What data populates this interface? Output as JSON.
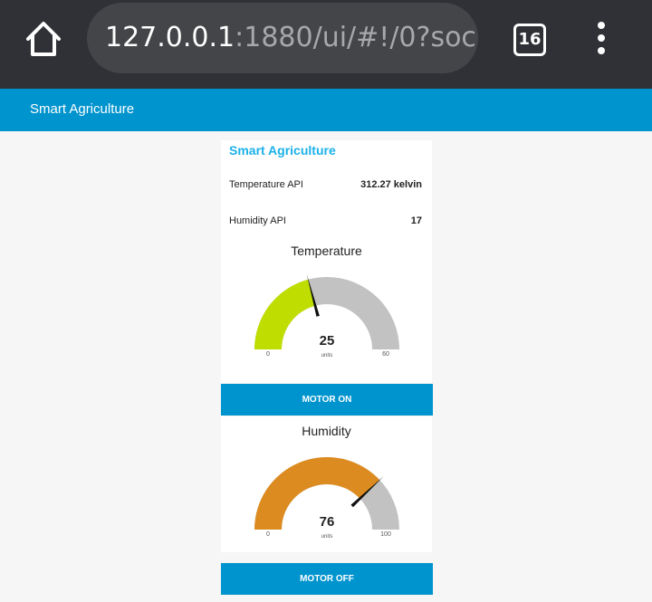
{
  "browser": {
    "url_host": "127.0.0.1",
    "url_path": ":1880/ui/#!/0?soc",
    "tab_count": "16"
  },
  "header": {
    "title": "Smart Agriculture"
  },
  "group": {
    "title": "Smart Agriculture",
    "temperature_api": {
      "label": "Temperature API",
      "value": "312.27 kelvin"
    },
    "humidity_api": {
      "label": "Humidity API",
      "value": "17"
    }
  },
  "gauges": {
    "temperature": {
      "title": "Temperature",
      "value": 25,
      "value_text": "25",
      "units": "units",
      "min": 0,
      "max": 60,
      "min_label": "0",
      "max_label": "60",
      "color": "#bfdd00"
    },
    "humidity": {
      "title": "Humidity",
      "value": 76,
      "value_text": "76",
      "units": "units",
      "min": 0,
      "max": 100,
      "min_label": "0",
      "max_label": "100",
      "color": "#dc8b20"
    }
  },
  "buttons": {
    "motor_on": "MOTOR ON",
    "motor_off": "MOTOR OFF"
  },
  "colors": {
    "accent": "#0094ce",
    "group_title": "#1ab1e8",
    "gauge_bg": "#c2c2c2"
  }
}
